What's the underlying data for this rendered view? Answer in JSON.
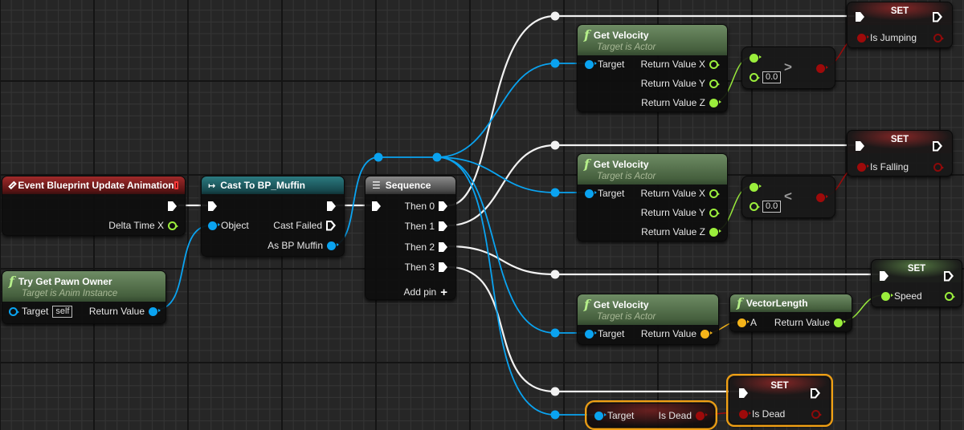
{
  "app": "Unreal Engine Animation Blueprint - Event Graph",
  "nodes": {
    "event_update": {
      "title": "Event Blueprint Update Animation",
      "icon": "event-diamond-icon",
      "pins": {
        "delta": "Delta Time X"
      }
    },
    "try_get_pawn": {
      "title": "Try Get Pawn Owner",
      "subtitle": "Target is Anim Instance",
      "pins": {
        "target": "Target",
        "target_default": "self",
        "return": "Return Value"
      }
    },
    "cast": {
      "title": "Cast To BP_Muffin",
      "icon": "cast-arrow-icon",
      "pins": {
        "object": "Object",
        "failed": "Cast Failed",
        "as": "As BP Muffin"
      }
    },
    "sequence": {
      "title": "Sequence",
      "icon": "sequence-icon",
      "pins": [
        "Then 0",
        "Then 1",
        "Then 2",
        "Then 3"
      ],
      "add_pin": "Add pin",
      "add_icon": "+"
    },
    "get_velocity_1": {
      "title": "Get Velocity",
      "subtitle": "Target is Actor",
      "pins": {
        "target": "Target",
        "x": "Return Value X",
        "y": "Return Value Y",
        "z": "Return Value Z"
      }
    },
    "compare_1": {
      "operator": ">",
      "value": "0.0"
    },
    "set_jumping": {
      "title": "SET",
      "var": "Is Jumping"
    },
    "get_velocity_2": {
      "title": "Get Velocity",
      "subtitle": "Target is Actor",
      "pins": {
        "target": "Target",
        "x": "Return Value X",
        "y": "Return Value Y",
        "z": "Return Value Z"
      }
    },
    "compare_2": {
      "operator": "<",
      "value": "0.0"
    },
    "set_falling": {
      "title": "SET",
      "var": "Is Falling"
    },
    "get_velocity_3": {
      "title": "Get Velocity",
      "subtitle": "Target is Actor",
      "pins": {
        "target": "Target",
        "return": "Return Value"
      }
    },
    "vector_length": {
      "title": "VectorLength",
      "pins": {
        "a": "A",
        "return": "Return Value"
      }
    },
    "set_speed": {
      "title": "SET",
      "var": "Speed"
    },
    "get_is_dead": {
      "pins": {
        "target": "Target",
        "value": "Is Dead"
      }
    },
    "set_dead": {
      "title": "SET",
      "var": "Is Dead"
    }
  },
  "colors": {
    "exec": "#ffffff",
    "object": "#0aa3f0",
    "float": "#9bee3c",
    "bool": "#9e0a0a",
    "vector": "#f4b41a",
    "selection": "#f0a014",
    "event_header": "#a02a2a",
    "cast_header": "#2b7a80",
    "function_header": "#6e8c64"
  }
}
